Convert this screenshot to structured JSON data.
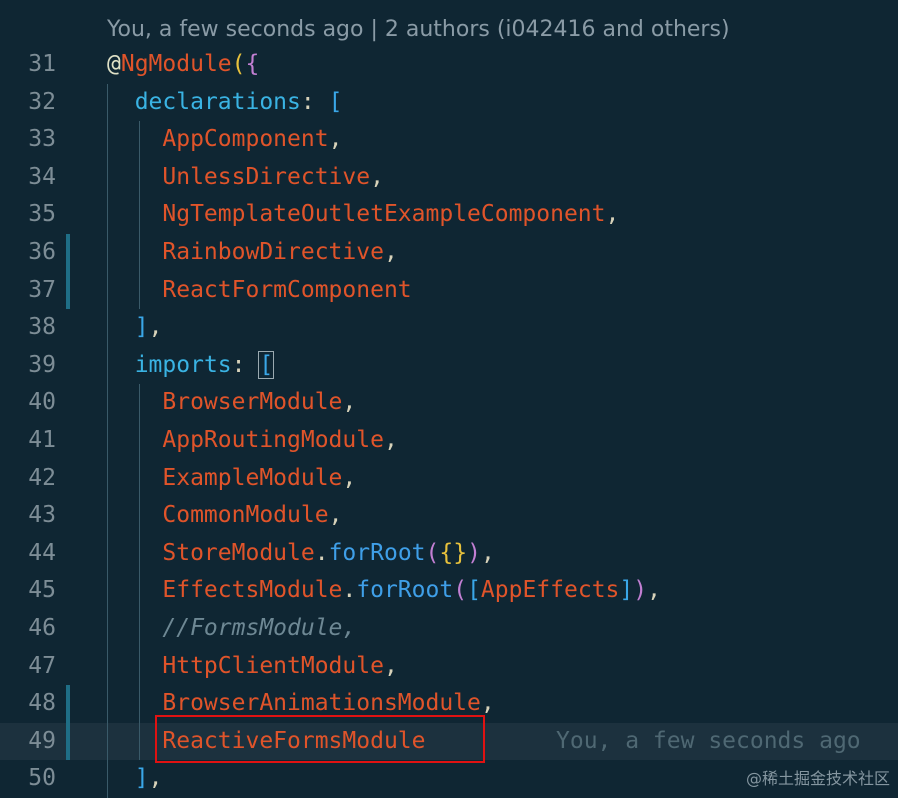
{
  "codelens": "You, a few seconds ago | 2 authors (i042416 and others)",
  "lines": [
    {
      "no": "31",
      "tokens": [
        {
          "t": "@",
          "c": "decor"
        },
        {
          "t": "NgModule",
          "c": "ident"
        },
        {
          "t": "(",
          "c": "b1"
        },
        {
          "t": "{",
          "c": "b2"
        }
      ]
    },
    {
      "no": "32",
      "tokens": [
        {
          "t": "  "
        },
        {
          "t": "declarations",
          "c": "key"
        },
        {
          "t": ": ",
          "c": "punct"
        },
        {
          "t": "[",
          "c": "b3"
        }
      ]
    },
    {
      "no": "33",
      "tokens": [
        {
          "t": "    "
        },
        {
          "t": "AppComponent",
          "c": "ident"
        },
        {
          "t": ",",
          "c": "punct"
        }
      ]
    },
    {
      "no": "34",
      "tokens": [
        {
          "t": "    "
        },
        {
          "t": "UnlessDirective",
          "c": "ident"
        },
        {
          "t": ",",
          "c": "punct"
        }
      ]
    },
    {
      "no": "35",
      "tokens": [
        {
          "t": "    "
        },
        {
          "t": "NgTemplateOutletExampleComponent",
          "c": "ident"
        },
        {
          "t": ",",
          "c": "punct"
        }
      ]
    },
    {
      "no": "36",
      "mark": true,
      "tokens": [
        {
          "t": "    "
        },
        {
          "t": "RainbowDirective",
          "c": "ident"
        },
        {
          "t": ",",
          "c": "punct"
        }
      ]
    },
    {
      "no": "37",
      "mark": true,
      "tokens": [
        {
          "t": "    "
        },
        {
          "t": "ReactFormComponent",
          "c": "ident"
        }
      ]
    },
    {
      "no": "38",
      "tokens": [
        {
          "t": "  "
        },
        {
          "t": "]",
          "c": "b3"
        },
        {
          "t": ",",
          "c": "punct"
        }
      ]
    },
    {
      "no": "39",
      "tokens": [
        {
          "t": "  "
        },
        {
          "t": "imports",
          "c": "key"
        },
        {
          "t": ": ",
          "c": "punct"
        },
        {
          "t": "[",
          "c": "b3 cursor-box"
        }
      ]
    },
    {
      "no": "40",
      "tokens": [
        {
          "t": "    "
        },
        {
          "t": "BrowserModule",
          "c": "ident"
        },
        {
          "t": ",",
          "c": "punct"
        }
      ]
    },
    {
      "no": "41",
      "tokens": [
        {
          "t": "    "
        },
        {
          "t": "AppRoutingModule",
          "c": "ident"
        },
        {
          "t": ",",
          "c": "punct"
        }
      ]
    },
    {
      "no": "42",
      "tokens": [
        {
          "t": "    "
        },
        {
          "t": "ExampleModule",
          "c": "ident"
        },
        {
          "t": ",",
          "c": "punct"
        }
      ]
    },
    {
      "no": "43",
      "tokens": [
        {
          "t": "    "
        },
        {
          "t": "CommonModule",
          "c": "ident"
        },
        {
          "t": ",",
          "c": "punct"
        }
      ]
    },
    {
      "no": "44",
      "tokens": [
        {
          "t": "    "
        },
        {
          "t": "StoreModule",
          "c": "ident"
        },
        {
          "t": ".",
          "c": "punct"
        },
        {
          "t": "forRoot",
          "c": "method"
        },
        {
          "t": "(",
          "c": "b2"
        },
        {
          "t": "{}",
          "c": "b1"
        },
        {
          "t": ")",
          "c": "b2"
        },
        {
          "t": ",",
          "c": "punct"
        }
      ]
    },
    {
      "no": "45",
      "tokens": [
        {
          "t": "    "
        },
        {
          "t": "EffectsModule",
          "c": "ident"
        },
        {
          "t": ".",
          "c": "punct"
        },
        {
          "t": "forRoot",
          "c": "method"
        },
        {
          "t": "(",
          "c": "b2"
        },
        {
          "t": "[",
          "c": "b3"
        },
        {
          "t": "AppEffects",
          "c": "ident"
        },
        {
          "t": "]",
          "c": "b3"
        },
        {
          "t": ")",
          "c": "b2"
        },
        {
          "t": ",",
          "c": "punct"
        }
      ]
    },
    {
      "no": "46",
      "tokens": [
        {
          "t": "    "
        },
        {
          "t": "//FormsModule,",
          "c": "comment"
        }
      ]
    },
    {
      "no": "47",
      "tokens": [
        {
          "t": "    "
        },
        {
          "t": "HttpClientModule",
          "c": "ident"
        },
        {
          "t": ",",
          "c": "punct"
        }
      ]
    },
    {
      "no": "48",
      "mark": true,
      "tokens": [
        {
          "t": "    "
        },
        {
          "t": "BrowserAnimationsModule",
          "c": "ident"
        },
        {
          "t": ",",
          "c": "punct"
        }
      ]
    },
    {
      "no": "49",
      "mark": true,
      "current": true,
      "ghost": "You, a few seconds ago",
      "tokens": [
        {
          "t": "    "
        },
        {
          "t": "ReactiveFormsModule",
          "c": "ident"
        }
      ]
    },
    {
      "no": "50",
      "tokens": [
        {
          "t": "  "
        },
        {
          "t": "]",
          "c": "b3"
        },
        {
          "t": ",",
          "c": "punct"
        }
      ]
    }
  ],
  "watermark": "@稀土掘金技术社区",
  "colors": {
    "background": "#0f2633",
    "identifier": "#e0542a",
    "keyword": "#3ab3e3",
    "highlight": "#e01212"
  }
}
